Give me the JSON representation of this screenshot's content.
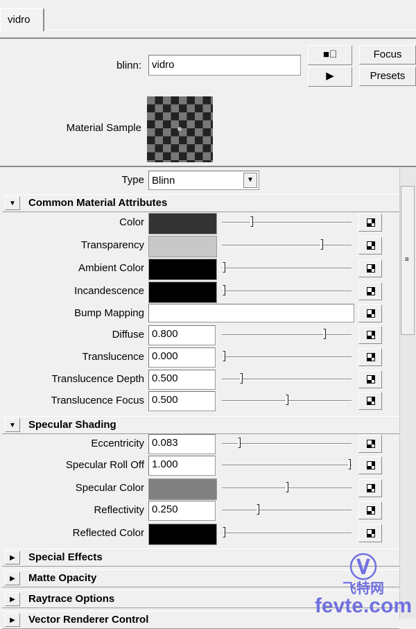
{
  "tab": {
    "label": "vidro"
  },
  "header": {
    "node_type_label": "blinn:",
    "node_name": "vidro",
    "focus": "Focus",
    "presets": "Presets",
    "sample_label": "Material Sample"
  },
  "type_row": {
    "label": "Type",
    "value": "Blinn"
  },
  "sections": [
    {
      "title": "Common Material Attributes",
      "expanded": true,
      "rows": [
        {
          "label": "Color",
          "kind": "color",
          "color": "#333333",
          "slider": 0.22
        },
        {
          "label": "Transparency",
          "kind": "color",
          "color": "#c8c8c8",
          "slider": 0.78
        },
        {
          "label": "Ambient Color",
          "kind": "color",
          "color": "#000000",
          "slider": 0
        },
        {
          "label": "Incandescence",
          "kind": "color",
          "color": "#000000",
          "slider": 0
        },
        {
          "label": "Bump Mapping",
          "kind": "map",
          "value": ""
        },
        {
          "label": "Diffuse",
          "kind": "num",
          "value": "0.800",
          "slider": 0.8
        },
        {
          "label": "Translucence",
          "kind": "num",
          "value": "0.000",
          "slider": 0
        },
        {
          "label": "Translucence Depth",
          "kind": "num",
          "value": "0.500",
          "slider": 0.14
        },
        {
          "label": "Translucence Focus",
          "kind": "num",
          "value": "0.500",
          "slider": 0.5
        }
      ]
    },
    {
      "title": "Specular Shading",
      "expanded": true,
      "rows": [
        {
          "label": "Eccentricity",
          "kind": "num",
          "value": "0.083",
          "slider": 0.12
        },
        {
          "label": "Specular Roll Off",
          "kind": "num",
          "value": "1.000",
          "slider": 1
        },
        {
          "label": "Specular Color",
          "kind": "color",
          "color": "#808080",
          "slider": 0.5
        },
        {
          "label": "Reflectivity",
          "kind": "num",
          "value": "0.250",
          "slider": 0.27
        },
        {
          "label": "Reflected Color",
          "kind": "color",
          "color": "#000000",
          "slider": 0
        }
      ]
    },
    {
      "title": "Special Effects",
      "expanded": false,
      "rows": []
    },
    {
      "title": "Matte Opacity",
      "expanded": false,
      "rows": []
    },
    {
      "title": "Raytrace Options",
      "expanded": false,
      "rows": []
    },
    {
      "title": "Vector Renderer Control",
      "expanded": false,
      "rows": []
    }
  ],
  "watermark": {
    "brand": "飞特网",
    "site": "fevte.com"
  }
}
